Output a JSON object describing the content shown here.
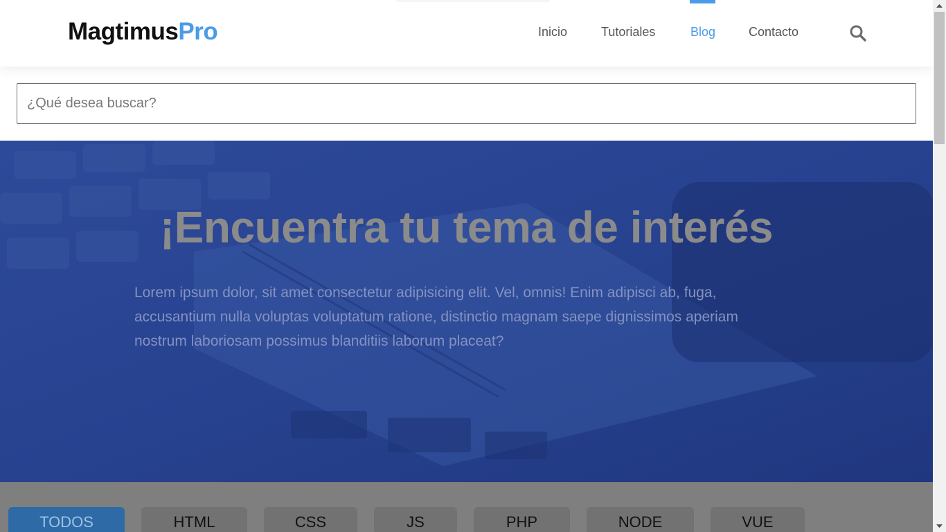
{
  "brand": {
    "name": "Magtimus",
    "accent": "Pro"
  },
  "nav": {
    "items": [
      {
        "label": "Inicio",
        "active": false
      },
      {
        "label": "Tutoriales",
        "active": false
      },
      {
        "label": "Blog",
        "active": true
      },
      {
        "label": "Contacto",
        "active": false
      }
    ],
    "search_icon": "search-icon"
  },
  "search": {
    "placeholder": "¿Qué desea buscar?",
    "value": ""
  },
  "hero": {
    "title": "¡Encuentra tu tema de interés",
    "text": "Lorem ipsum dolor, sit amet consectetur adipisicing elit. Vel, omnis! Enim adipisci ab, fuga, accusantium nulla voluptas voluptatum ratione, distinctio magnam saepe dignissimos aperiam nostrum laboriosam possimus blanditiis laborum placeat?"
  },
  "filters": {
    "items": [
      {
        "label": "TODOS",
        "active": true
      },
      {
        "label": "HTML",
        "active": false
      },
      {
        "label": "CSS",
        "active": false
      },
      {
        "label": "JS",
        "active": false
      },
      {
        "label": "PHP",
        "active": false
      },
      {
        "label": "NODE",
        "active": false
      },
      {
        "label": "VUE",
        "active": false
      }
    ]
  },
  "colors": {
    "accent": "#4a9be8",
    "hero_bg": "#25408f",
    "nav_text": "#555555",
    "filter_active": "#2e6aa5"
  }
}
